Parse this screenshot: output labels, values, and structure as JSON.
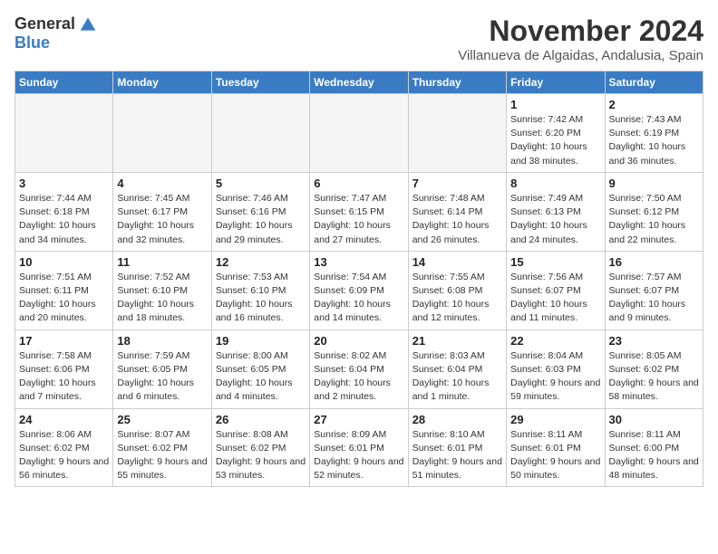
{
  "logo": {
    "general": "General",
    "blue": "Blue"
  },
  "title": "November 2024",
  "location": "Villanueva de Algaidas, Andalusia, Spain",
  "days_of_week": [
    "Sunday",
    "Monday",
    "Tuesday",
    "Wednesday",
    "Thursday",
    "Friday",
    "Saturday"
  ],
  "weeks": [
    [
      {
        "day": "",
        "info": ""
      },
      {
        "day": "",
        "info": ""
      },
      {
        "day": "",
        "info": ""
      },
      {
        "day": "",
        "info": ""
      },
      {
        "day": "",
        "info": ""
      },
      {
        "day": "1",
        "info": "Sunrise: 7:42 AM\nSunset: 6:20 PM\nDaylight: 10 hours and 38 minutes."
      },
      {
        "day": "2",
        "info": "Sunrise: 7:43 AM\nSunset: 6:19 PM\nDaylight: 10 hours and 36 minutes."
      }
    ],
    [
      {
        "day": "3",
        "info": "Sunrise: 7:44 AM\nSunset: 6:18 PM\nDaylight: 10 hours and 34 minutes."
      },
      {
        "day": "4",
        "info": "Sunrise: 7:45 AM\nSunset: 6:17 PM\nDaylight: 10 hours and 32 minutes."
      },
      {
        "day": "5",
        "info": "Sunrise: 7:46 AM\nSunset: 6:16 PM\nDaylight: 10 hours and 29 minutes."
      },
      {
        "day": "6",
        "info": "Sunrise: 7:47 AM\nSunset: 6:15 PM\nDaylight: 10 hours and 27 minutes."
      },
      {
        "day": "7",
        "info": "Sunrise: 7:48 AM\nSunset: 6:14 PM\nDaylight: 10 hours and 26 minutes."
      },
      {
        "day": "8",
        "info": "Sunrise: 7:49 AM\nSunset: 6:13 PM\nDaylight: 10 hours and 24 minutes."
      },
      {
        "day": "9",
        "info": "Sunrise: 7:50 AM\nSunset: 6:12 PM\nDaylight: 10 hours and 22 minutes."
      }
    ],
    [
      {
        "day": "10",
        "info": "Sunrise: 7:51 AM\nSunset: 6:11 PM\nDaylight: 10 hours and 20 minutes."
      },
      {
        "day": "11",
        "info": "Sunrise: 7:52 AM\nSunset: 6:10 PM\nDaylight: 10 hours and 18 minutes."
      },
      {
        "day": "12",
        "info": "Sunrise: 7:53 AM\nSunset: 6:10 PM\nDaylight: 10 hours and 16 minutes."
      },
      {
        "day": "13",
        "info": "Sunrise: 7:54 AM\nSunset: 6:09 PM\nDaylight: 10 hours and 14 minutes."
      },
      {
        "day": "14",
        "info": "Sunrise: 7:55 AM\nSunset: 6:08 PM\nDaylight: 10 hours and 12 minutes."
      },
      {
        "day": "15",
        "info": "Sunrise: 7:56 AM\nSunset: 6:07 PM\nDaylight: 10 hours and 11 minutes."
      },
      {
        "day": "16",
        "info": "Sunrise: 7:57 AM\nSunset: 6:07 PM\nDaylight: 10 hours and 9 minutes."
      }
    ],
    [
      {
        "day": "17",
        "info": "Sunrise: 7:58 AM\nSunset: 6:06 PM\nDaylight: 10 hours and 7 minutes."
      },
      {
        "day": "18",
        "info": "Sunrise: 7:59 AM\nSunset: 6:05 PM\nDaylight: 10 hours and 6 minutes."
      },
      {
        "day": "19",
        "info": "Sunrise: 8:00 AM\nSunset: 6:05 PM\nDaylight: 10 hours and 4 minutes."
      },
      {
        "day": "20",
        "info": "Sunrise: 8:02 AM\nSunset: 6:04 PM\nDaylight: 10 hours and 2 minutes."
      },
      {
        "day": "21",
        "info": "Sunrise: 8:03 AM\nSunset: 6:04 PM\nDaylight: 10 hours and 1 minute."
      },
      {
        "day": "22",
        "info": "Sunrise: 8:04 AM\nSunset: 6:03 PM\nDaylight: 9 hours and 59 minutes."
      },
      {
        "day": "23",
        "info": "Sunrise: 8:05 AM\nSunset: 6:02 PM\nDaylight: 9 hours and 58 minutes."
      }
    ],
    [
      {
        "day": "24",
        "info": "Sunrise: 8:06 AM\nSunset: 6:02 PM\nDaylight: 9 hours and 56 minutes."
      },
      {
        "day": "25",
        "info": "Sunrise: 8:07 AM\nSunset: 6:02 PM\nDaylight: 9 hours and 55 minutes."
      },
      {
        "day": "26",
        "info": "Sunrise: 8:08 AM\nSunset: 6:02 PM\nDaylight: 9 hours and 53 minutes."
      },
      {
        "day": "27",
        "info": "Sunrise: 8:09 AM\nSunset: 6:01 PM\nDaylight: 9 hours and 52 minutes."
      },
      {
        "day": "28",
        "info": "Sunrise: 8:10 AM\nSunset: 6:01 PM\nDaylight: 9 hours and 51 minutes."
      },
      {
        "day": "29",
        "info": "Sunrise: 8:11 AM\nSunset: 6:01 PM\nDaylight: 9 hours and 50 minutes."
      },
      {
        "day": "30",
        "info": "Sunrise: 8:11 AM\nSunset: 6:00 PM\nDaylight: 9 hours and 48 minutes."
      }
    ]
  ]
}
